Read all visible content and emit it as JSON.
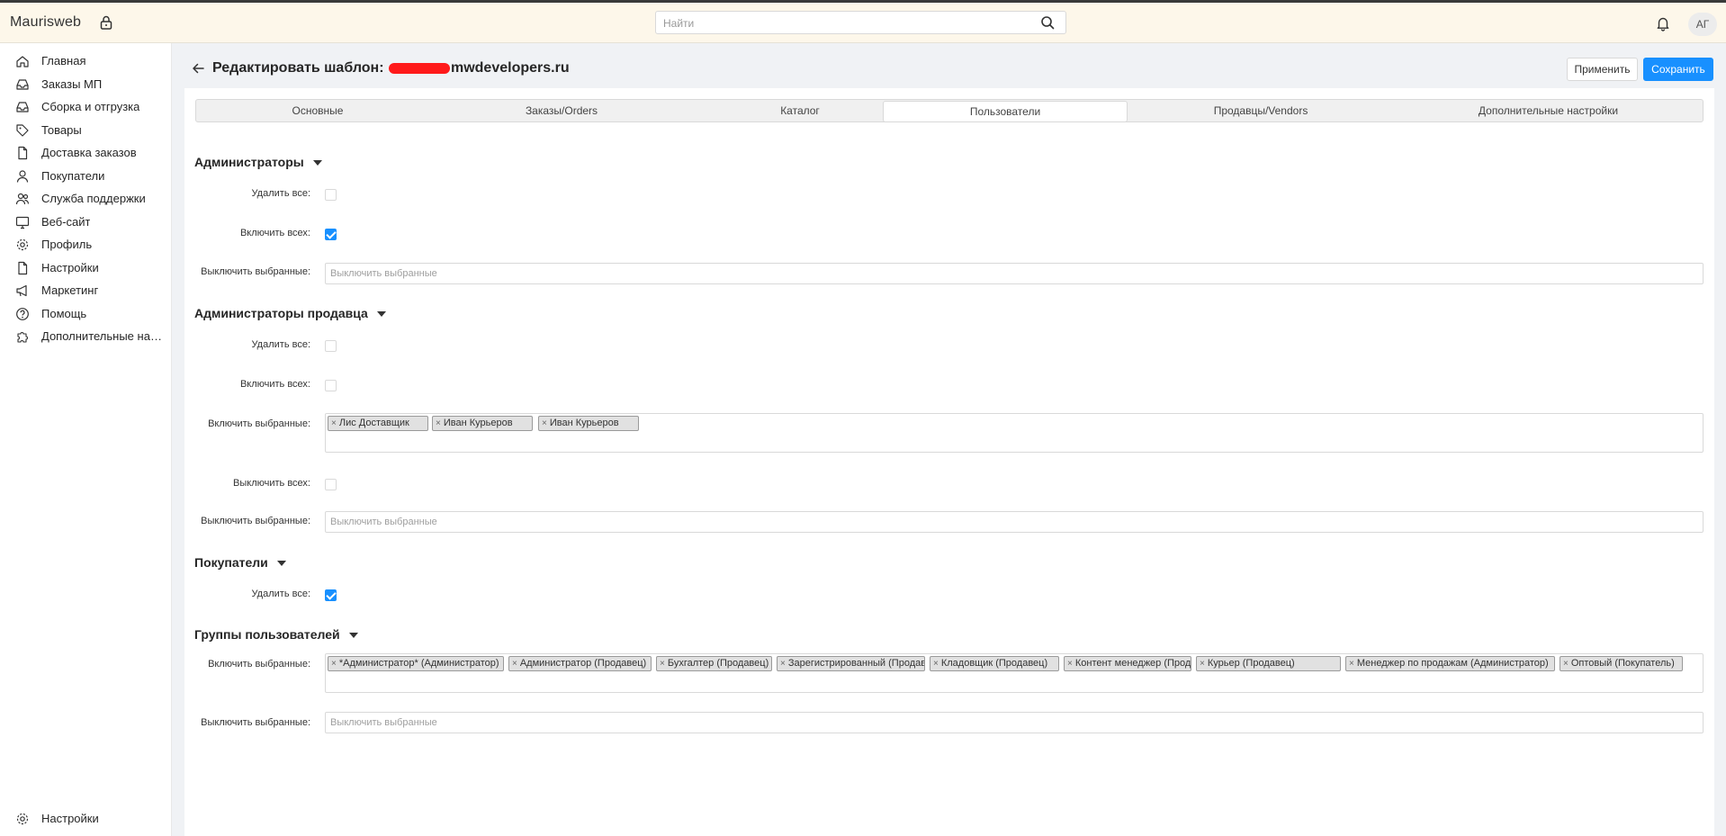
{
  "topbar": {
    "brand": "Maurisweb",
    "search_placeholder": "Найти",
    "avatar_initials": "АГ"
  },
  "sidebar": {
    "items": [
      {
        "label": "Главная",
        "icon": "home-icon"
      },
      {
        "label": "Заказы МП",
        "icon": "inbox-icon"
      },
      {
        "label": "Сборка и отгрузка",
        "icon": "inbox-icon"
      },
      {
        "label": "Товары",
        "icon": "tag-icon"
      },
      {
        "label": "Доставка заказов",
        "icon": "file-icon"
      },
      {
        "label": "Покупатели",
        "icon": "user-icon"
      },
      {
        "label": "Служба поддержки",
        "icon": "team-icon"
      },
      {
        "label": "Веб-сайт",
        "icon": "monitor-icon"
      },
      {
        "label": "Профиль",
        "icon": "gear-icon"
      },
      {
        "label": "Настройки",
        "icon": "file-icon"
      },
      {
        "label": "Маркетинг",
        "icon": "megaphone-icon"
      },
      {
        "label": "Помощь",
        "icon": "question-icon"
      },
      {
        "label": "Дополнительные нас...",
        "icon": "puzzle-icon"
      }
    ],
    "bottom_item": {
      "label": "Настройки",
      "icon": "gear-icon"
    }
  },
  "header": {
    "title_prefix": "Редактировать шаблон: ",
    "title_suffix": "mwdevelopers.ru",
    "apply_label": "Применить",
    "save_label": "Сохранить"
  },
  "tabs": [
    {
      "label": "Основные",
      "active": false
    },
    {
      "label": "Заказы/Orders",
      "active": false
    },
    {
      "label": "Каталог",
      "active": false
    },
    {
      "label": "Пользователи",
      "active": true
    },
    {
      "label": "Продавцы/Vendors",
      "active": false
    },
    {
      "label": "Дополнительные настройки",
      "active": false
    }
  ],
  "sections": {
    "admins": {
      "title": "Администраторы",
      "delete_all_label": "Удалить все:",
      "delete_all_checked": false,
      "enable_all_label": "Включить всех:",
      "enable_all_checked": true,
      "disable_selected_label": "Выключить выбранные:",
      "disable_selected_placeholder": "Выключить выбранные"
    },
    "vendor_admins": {
      "title": "Администраторы продавца",
      "delete_all_label": "Удалить все:",
      "delete_all_checked": false,
      "enable_all_label": "Включить всех:",
      "enable_all_checked": false,
      "enable_selected_label": "Включить выбранные:",
      "enable_selected_tags": [
        "Лис Доставщик",
        "Иван Курьеров",
        "Иван Курьеров"
      ],
      "disable_all_label": "Выключить всех:",
      "disable_all_checked": false,
      "disable_selected_label": "Выключить выбранные:",
      "disable_selected_placeholder": "Выключить выбранные"
    },
    "customers": {
      "title": "Покупатели",
      "delete_all_label": "Удалить все:",
      "delete_all_checked": true
    },
    "user_groups": {
      "title": "Группы пользователей",
      "enable_selected_label": "Включить выбранные:",
      "enable_selected_tags": [
        "*Администратор* (Администратор)",
        "Администратор (Продавец)",
        "Бухгалтер (Продавец)",
        "Зарегистрированный (Продавец)",
        "Кладовщик (Продавец)",
        "Контент менеджер (Продавец)",
        "Курьер (Продавец)",
        "Менеджер по продажам (Администратор)",
        "Оптовый (Покупатель)"
      ],
      "disable_selected_label": "Выключить выбранные:",
      "disable_selected_placeholder": "Выключить выбранные"
    }
  }
}
